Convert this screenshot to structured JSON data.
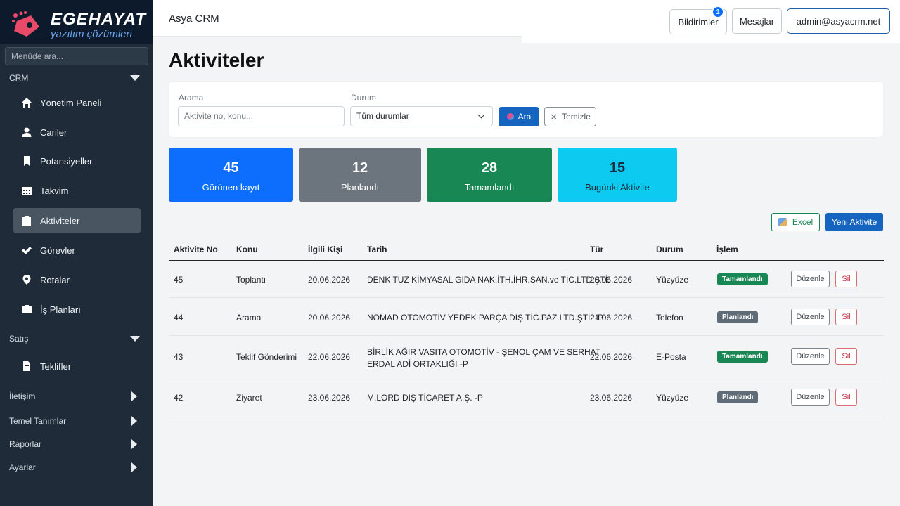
{
  "sidebar": {
    "logo_title": "EGEHAYAT",
    "logo_subtitle": "yazılım çözümleri",
    "search_placeholder": "Menüde ara...",
    "sections": {
      "crm": "CRM",
      "satis": "Satış",
      "iletisim": "İletişim",
      "temel": "Temel Tanımlar",
      "raporlar": "Raporlar",
      "ayarlar": "Ayarlar"
    },
    "crm_items": [
      {
        "label": "Yönetim Paneli",
        "icon": "home-icon"
      },
      {
        "label": "Cariler",
        "icon": "user-icon"
      },
      {
        "label": "Potansiyeller",
        "icon": "bookmark-icon"
      },
      {
        "label": "Takvim",
        "icon": "calendar-icon"
      },
      {
        "label": "Aktiviteler",
        "icon": "clipboard-icon"
      },
      {
        "label": "Görevler",
        "icon": "check-icon"
      },
      {
        "label": "Rotalar",
        "icon": "map-pin-icon"
      },
      {
        "label": "İş Planları",
        "icon": "briefcase-icon"
      }
    ],
    "satis_items": [
      {
        "label": "Teklifler",
        "icon": "document-icon"
      }
    ]
  },
  "header": {
    "brand": "Asya CRM",
    "notifications_label": "Bildirimler",
    "notifications_count": "1",
    "messages_label": "Mesajlar",
    "user_email": "admin@asyacrm.net"
  },
  "page": {
    "title": "Aktiviteler"
  },
  "filters": {
    "search_label": "Arama",
    "search_placeholder": "Aktivite no, konu...",
    "status_label": "Durum",
    "status_value": "Tüm durumlar",
    "search_button": "Ara",
    "clear_button": "Temizle"
  },
  "stats": [
    {
      "value": "45",
      "label": "Görünen kayıt",
      "color": "#0d6efd"
    },
    {
      "value": "12",
      "label": "Planlandı",
      "color": "#6c757d"
    },
    {
      "value": "28",
      "label": "Tamamlandı",
      "color": "#198754"
    },
    {
      "value": "15",
      "label": "Bugünki Aktivite",
      "color": "#0dcaf0"
    }
  ],
  "actions": {
    "excel": "Excel",
    "new_activity": "Yeni Aktivite"
  },
  "table": {
    "headers": [
      "Aktivite No",
      "Konu",
      "İlgili Kişi",
      "Tarih",
      "Tür",
      "Durum",
      "İşlem"
    ],
    "rows": [
      {
        "no": "45",
        "konu": "Toplantı",
        "tarih": "20.06.2026",
        "firma": "DENK TUZ KİMYASAL GIDA NAK.İTH.İHR.SAN.ve TİC.LTD.ŞTİ.",
        "firma2": "",
        "tarih2": "20.06.2026",
        "tur": "Yüzyüze",
        "durum": "Tamamlandı",
        "durum_color": "green",
        "edit": "Düzenle",
        "delete": "Sil"
      },
      {
        "no": "44",
        "konu": "Arama",
        "tarih": "20.06.2026",
        "firma": "NOMAD OTOMOTİV YEDEK PARÇA DIŞ TİC.PAZ.LTD.ŞTİ. -P",
        "firma2": "",
        "tarih2": "21.06.2026",
        "tur": "Telefon",
        "durum": "Planlandı",
        "durum_color": "grey",
        "edit": "Düzenle",
        "delete": "Sil"
      },
      {
        "no": "43",
        "konu": "Teklif Gönderimi",
        "tarih": "22.06.2026",
        "firma": "BİRLİK AĞIR VASITA OTOMOTİV - ŞENOL ÇAM VE SERHAT",
        "firma2": "ERDAL ADİ ORTAKLIĞI -P",
        "tarih2": "22.06.2026",
        "tur": "E-Posta",
        "durum": "Tamamlandı",
        "durum_color": "green",
        "edit": "Düzenle",
        "delete": "Sil"
      },
      {
        "no": "42",
        "konu": "Ziyaret",
        "tarih": "23.06.2026",
        "firma": "M.LORD DIŞ TİCARET A.Ş. -P",
        "firma2": "",
        "tarih2": "23.06.2026",
        "tur": "Yüzyüze",
        "durum": "Planlandı",
        "durum_color": "grey",
        "edit": "Düzenle",
        "delete": "Sil"
      }
    ]
  }
}
